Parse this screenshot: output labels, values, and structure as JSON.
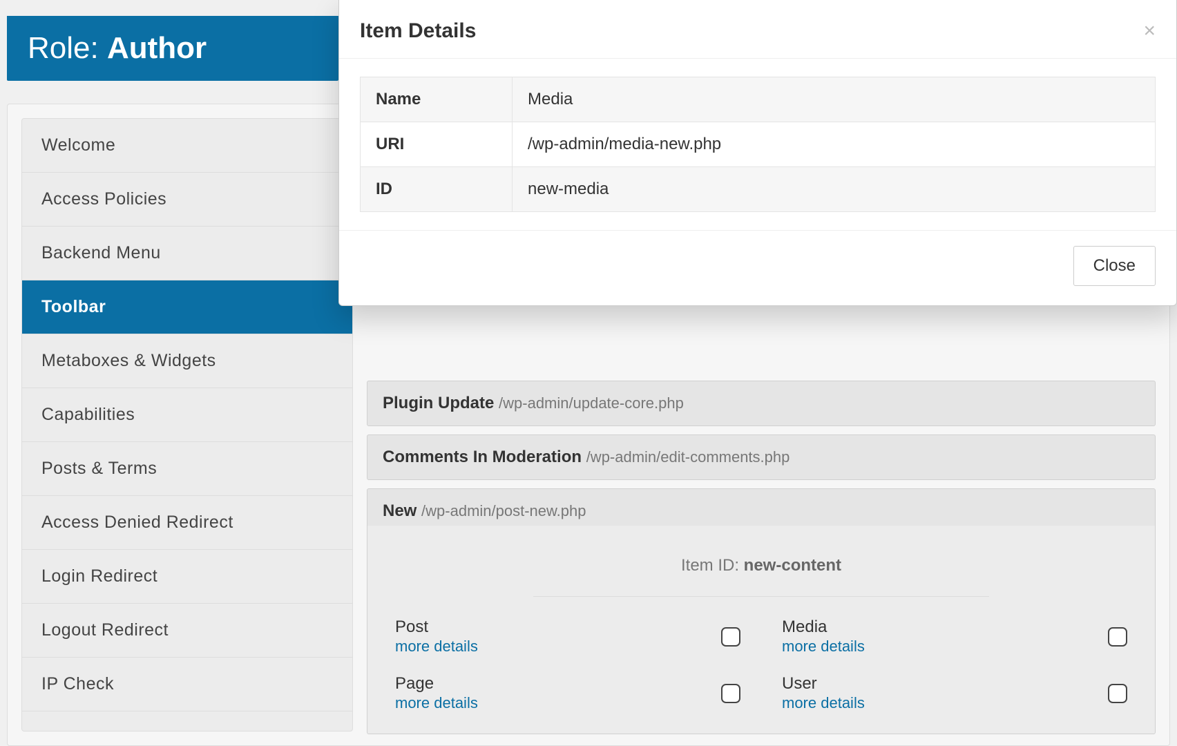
{
  "header": {
    "prefix": "Role: ",
    "name": "Author"
  },
  "sidebar": {
    "items": [
      "Welcome",
      "Access Policies",
      "Backend Menu",
      "Toolbar",
      "Metaboxes & Widgets",
      "Capabilities",
      "Posts & Terms",
      "Access Denied Redirect",
      "Login Redirect",
      "Logout Redirect",
      "IP Check"
    ],
    "active_index": 3
  },
  "main": {
    "rows": [
      {
        "title": "Plugin Update",
        "path": "/wp-admin/update-core.php"
      },
      {
        "title": "Comments In Moderation",
        "path": "/wp-admin/edit-comments.php"
      },
      {
        "title": "New",
        "path": "/wp-admin/post-new.php"
      }
    ],
    "sub": {
      "item_id_label": "Item ID: ",
      "item_id_value": "new-content",
      "more_details": "more details",
      "items": [
        {
          "name": "Post"
        },
        {
          "name": "Media"
        },
        {
          "name": "Page"
        },
        {
          "name": "User"
        }
      ]
    }
  },
  "modal": {
    "title": "Item Details",
    "close_label": "Close",
    "rows": [
      {
        "label": "Name",
        "value": "Media"
      },
      {
        "label": "URI",
        "value": "/wp-admin/media-new.php"
      },
      {
        "label": "ID",
        "value": "new-media"
      }
    ]
  }
}
